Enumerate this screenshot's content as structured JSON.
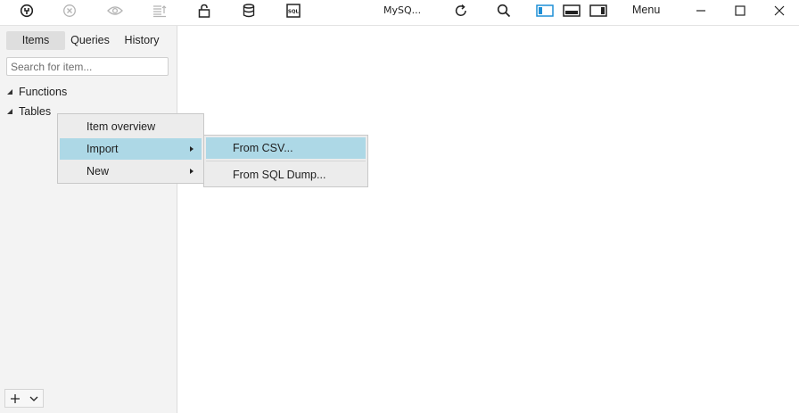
{
  "toolbar": {
    "icons": [
      "connection-icon",
      "disconnect-icon",
      "eye-icon",
      "list-icon",
      "lock-icon",
      "database-icon",
      "sql-icon"
    ],
    "connection_title": "MySQ...",
    "right_icons": [
      "refresh-icon",
      "search-icon",
      "layout-left-icon",
      "layout-bottom-icon",
      "layout-right-icon"
    ],
    "menu_label": "Menu",
    "window_controls": [
      "minimize-icon",
      "maximize-icon",
      "close-icon"
    ]
  },
  "sidebar": {
    "tabs": [
      {
        "label": "Items",
        "active": true
      },
      {
        "label": "Queries",
        "active": false
      },
      {
        "label": "History",
        "active": false
      }
    ],
    "search_placeholder": "Search for item...",
    "tree": [
      {
        "label": "Functions"
      },
      {
        "label": "Tables"
      }
    ]
  },
  "context_menu": {
    "items": [
      {
        "label": "Item overview",
        "has_submenu": false
      },
      {
        "label": "Import",
        "has_submenu": true,
        "highlighted": true
      },
      {
        "label": "New",
        "has_submenu": true
      }
    ]
  },
  "submenu": {
    "items": [
      {
        "label": "From CSV...",
        "highlighted": true
      },
      {
        "label": "From SQL Dump..."
      }
    ]
  },
  "colors": {
    "highlight": "#add8e6",
    "sidebar_bg": "#f3f3f3",
    "menu_bg": "#ececec",
    "layout_active": "#1e8fd6"
  }
}
